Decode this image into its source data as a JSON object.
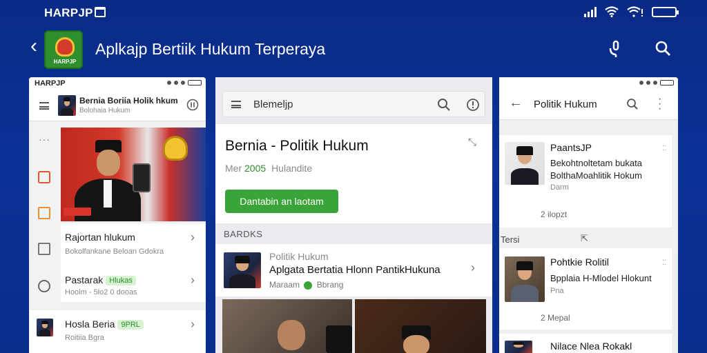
{
  "status": {
    "brand": "HARPJP"
  },
  "app": {
    "title": "Aplkajp Bertiik Hukum Terperaya",
    "logo_text": "HARPJP"
  },
  "panel1": {
    "mini_brand": "HARPJP",
    "title": "Bernia Boriia Holik hkum",
    "subtitle": "Bolohaia Hukum",
    "items": [
      {
        "title": "Rajortan hlukum",
        "subtitle": "Bokolfankane Beloan Gdokra"
      },
      {
        "title": "Pastarak",
        "badge": "Hlukas",
        "subtitle": "Hoolm - 5lo2 0 dooas"
      },
      {
        "title": "Hosla Beria",
        "badge": "9PRL",
        "subtitle": "Roitiia Bgra"
      }
    ]
  },
  "panel2": {
    "search_text": "Blemeljp",
    "headline": "Bernia - Politik Hukum",
    "meta_prefix": "Mer",
    "meta_year": "2005",
    "meta_suffix": "Hulandite",
    "cta_label": "Dantabin an laotam",
    "section_label": "BARDKS",
    "list_item": {
      "kicker": "Politik Hukum",
      "title": "Aplgata Bertatia Hlonn PantikHukuna",
      "meta_prefix": "Maraam",
      "meta_suffix": "Bbrang"
    }
  },
  "panel3": {
    "title": "Politik Hukum",
    "card1": {
      "name": "PaantsJP",
      "line1": "Bekohtnoltetam bukata",
      "line2": "BolthaMoahlitik Hokum",
      "line3": "Darm",
      "footer": "2 ilopzt"
    },
    "section_label": "Tersi",
    "card2": {
      "name": "Pohtkie Rolitil",
      "line1": "Bpplaia H-Mlodel Hlokunt",
      "line2": "Pna",
      "footer": "2 Mepal"
    },
    "card3": {
      "name": "Nilace Nlea Rokakl"
    }
  }
}
